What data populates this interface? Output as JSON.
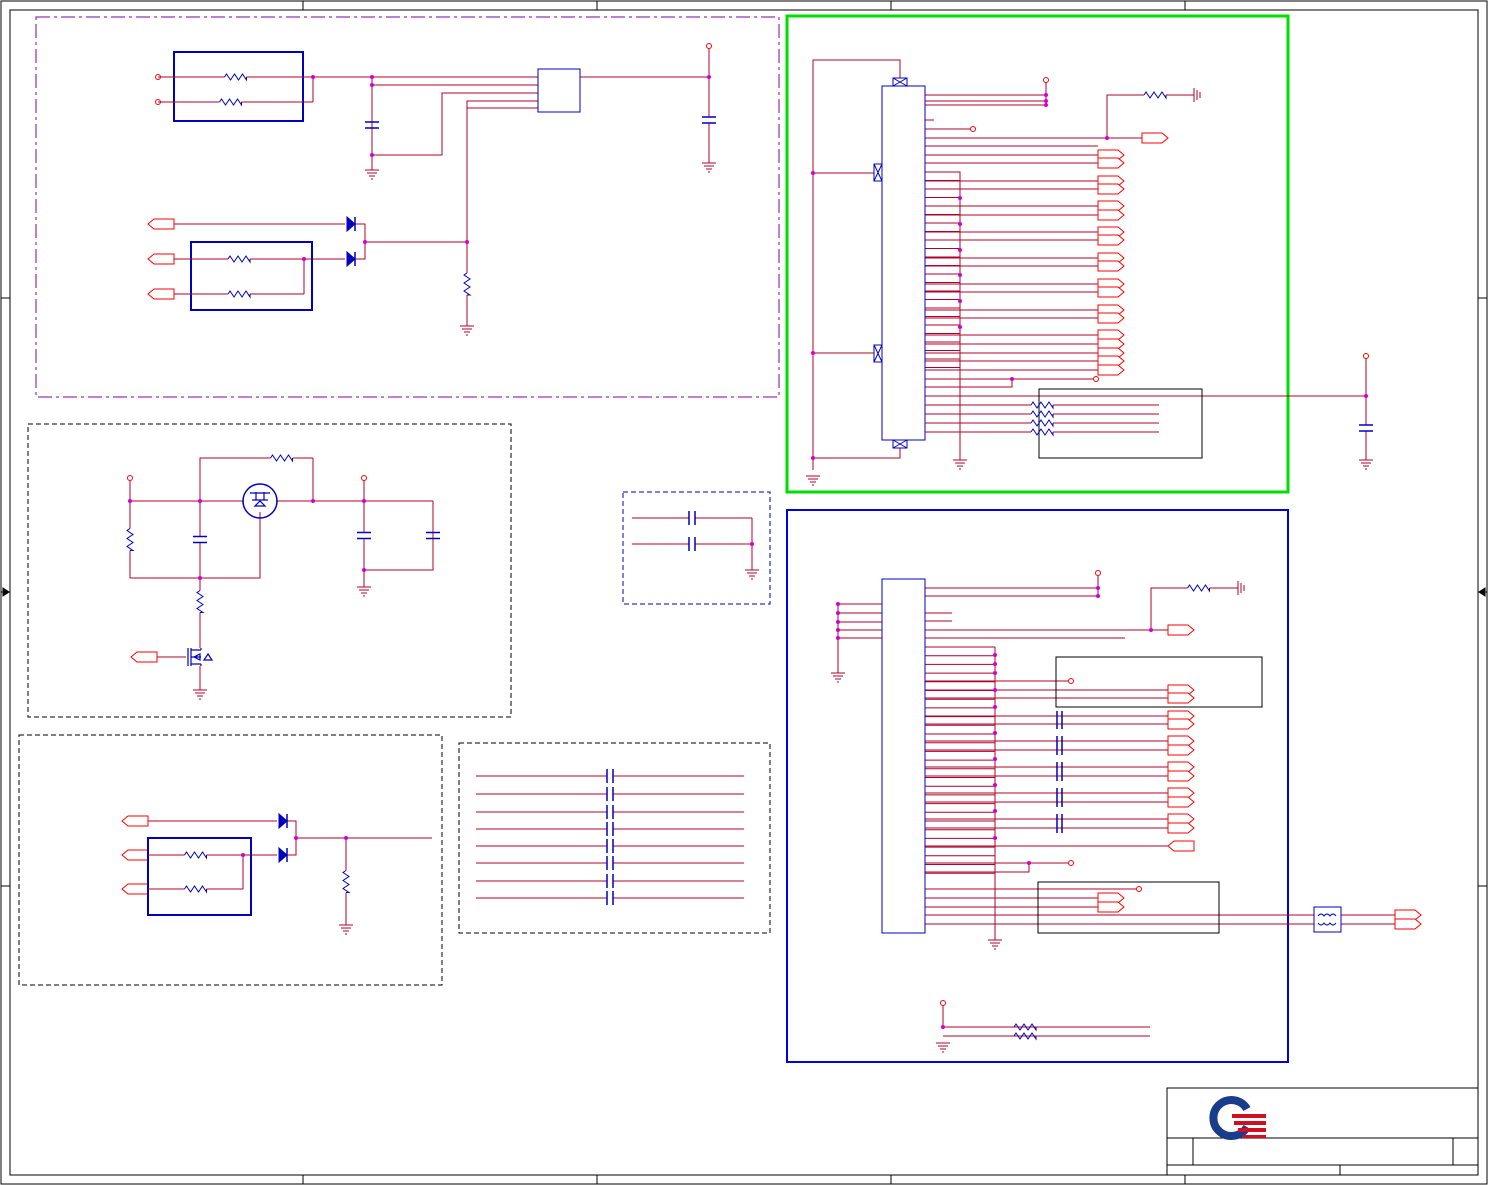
{
  "diagram": {
    "kind": "schematic",
    "text": [],
    "colors": {
      "wire": "#b0002a",
      "net_dot": "#d000d0",
      "pin": "#ff0000",
      "part": "#0000c0",
      "frame": "#000000",
      "block_outline": "#000000",
      "top_block_outline": "#8000a0",
      "lcd_section": "#00dd00",
      "lvds_section": "#0000e0",
      "logo_blue": "#1a3c8c",
      "logo_red": "#d01020"
    },
    "blocks": [
      {
        "id": "power-switch-block",
        "style": "dash-dot",
        "color": "#8000a0"
      },
      {
        "id": "mosfet-switch-block",
        "style": "dashed"
      },
      {
        "id": "decoupling-block",
        "style": "dashed",
        "color": "#0000c0"
      },
      {
        "id": "diode-or-block",
        "style": "dashed"
      },
      {
        "id": "capacitor-array-block",
        "style": "dashed"
      },
      {
        "id": "lcd-connector-section",
        "style": "solid",
        "color": "#00dd00"
      },
      {
        "id": "lvds-connector-section",
        "style": "solid",
        "color": "#0000e0"
      }
    ],
    "icons": [
      "logo-icon",
      "resistor-icon",
      "capacitor-icon",
      "diode-icon",
      "ground-icon",
      "mosfet-icon",
      "connector-icon",
      "common-mode-choke-icon"
    ]
  }
}
